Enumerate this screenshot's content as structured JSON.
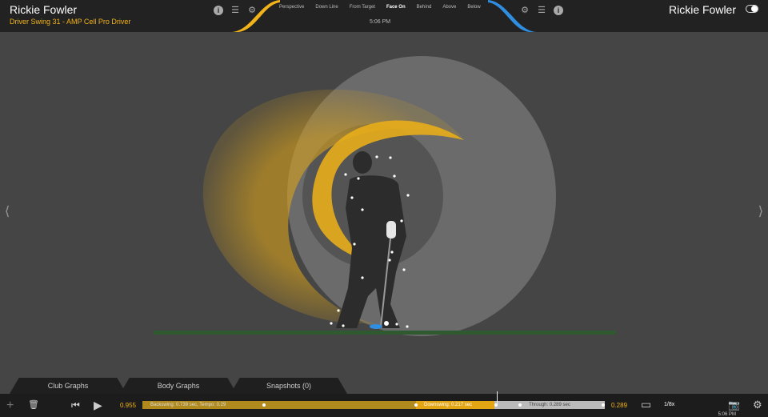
{
  "header": {
    "player_left": "Rickie Fowler",
    "swing_name": "Driver Swing 31 - AMP Cell Pro Driver",
    "player_right": "Rickie Fowler",
    "time": "5:06 PM"
  },
  "views": [
    {
      "label": "Perspective",
      "active": false
    },
    {
      "label": "Down Line",
      "active": false
    },
    {
      "label": "From Target",
      "active": false
    },
    {
      "label": "Face On",
      "active": true
    },
    {
      "label": "Behind",
      "active": false
    },
    {
      "label": "Above",
      "active": false
    },
    {
      "label": "Below",
      "active": false
    }
  ],
  "icons": {
    "info": "i",
    "list": "☰",
    "gear": "⚙",
    "prev": "⟨",
    "next": "⟩",
    "add": "+",
    "trash": "🗑",
    "rewind": "⏮",
    "play": "▶",
    "frame": "▭",
    "camera": "📷"
  },
  "tabs": [
    {
      "label": "Club Graphs"
    },
    {
      "label": "Body Graphs"
    },
    {
      "label": "Snapshots (0)"
    }
  ],
  "playback": {
    "start_value": "0.955",
    "end_value": "0.289",
    "backswing": "Backswing: 0.739 sec, Tempo: 0.29",
    "downswing": "Downswing: 0.217 sec",
    "through": "Through: 0.289 sec",
    "speed": "1/8x",
    "time": "5:06 PM"
  },
  "colors": {
    "accent_gold": "#f2b31a",
    "accent_blue": "#2f8ee0",
    "background": "#454545"
  }
}
